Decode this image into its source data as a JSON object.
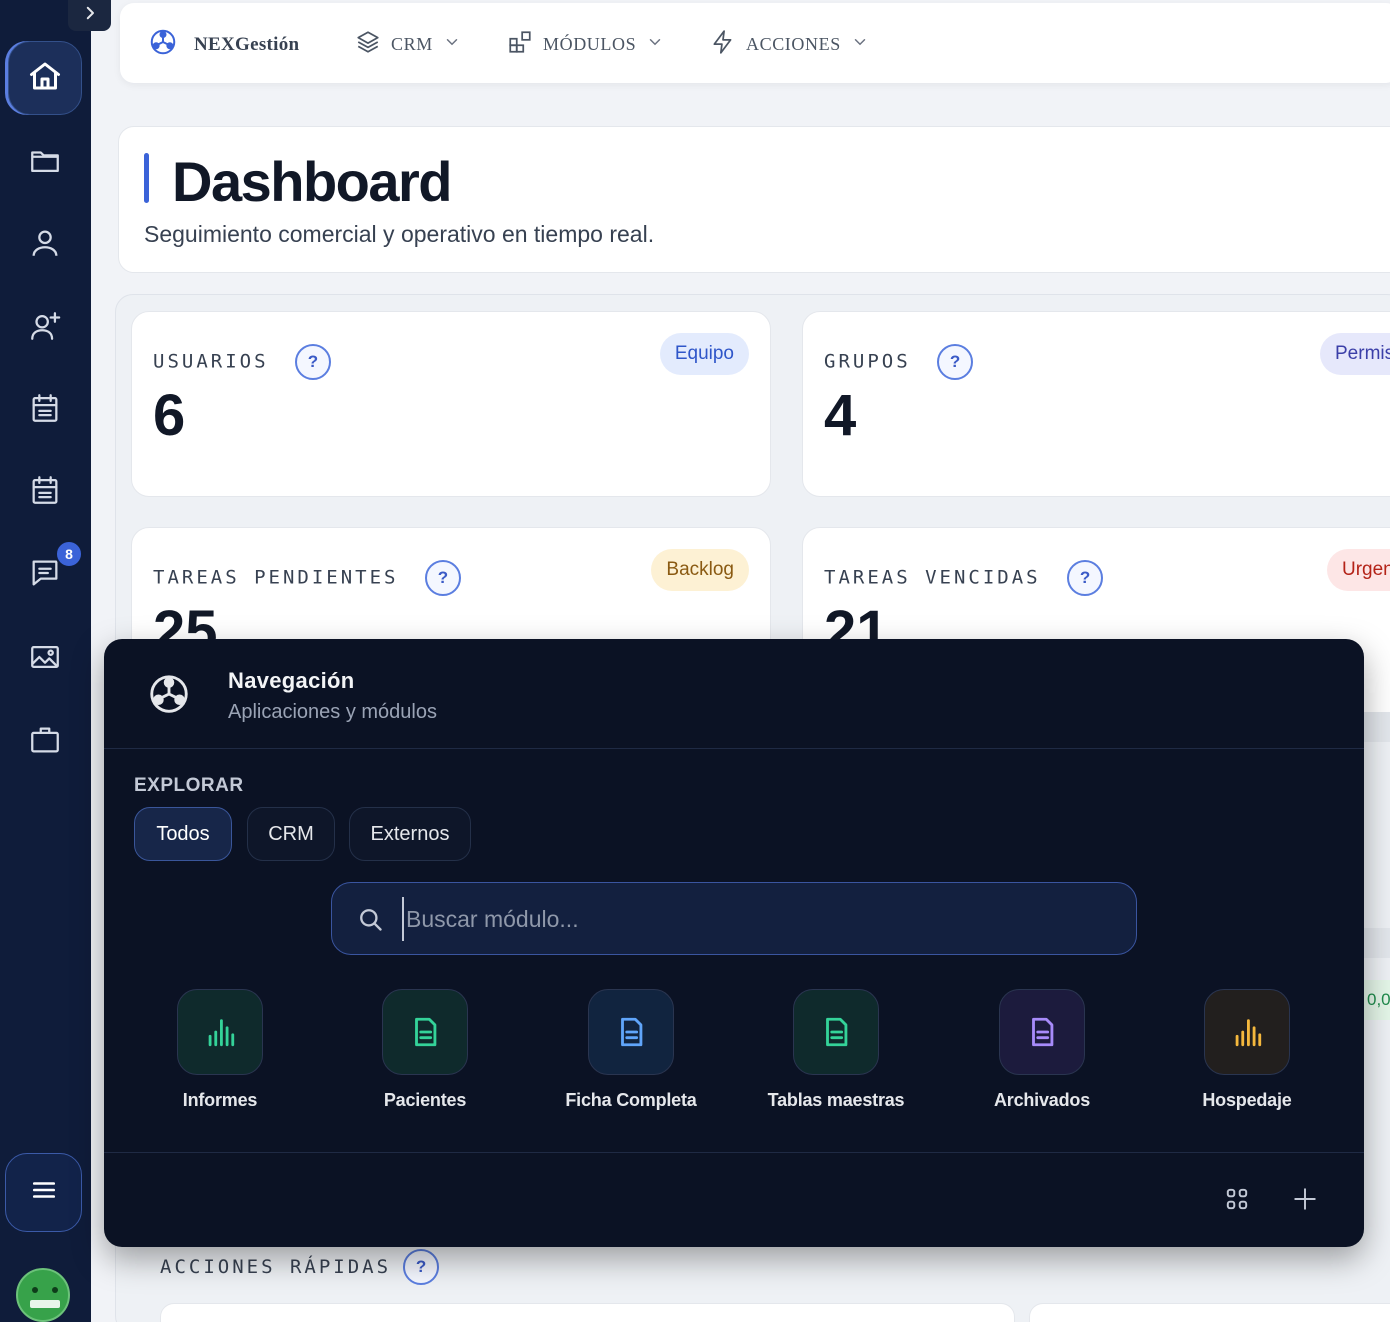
{
  "topbar": {
    "brand": "NEXGestión",
    "nav": [
      {
        "label": "CRM",
        "icon": "layers-icon"
      },
      {
        "label": "MÓDULOS",
        "icon": "blocks-icon"
      },
      {
        "label": "ACCIONES",
        "icon": "bolt-icon"
      }
    ]
  },
  "sidebar": {
    "items": [
      {
        "name": "home",
        "icon": "home-icon"
      },
      {
        "name": "folder",
        "icon": "folder-icon"
      },
      {
        "name": "user",
        "icon": "user-icon"
      },
      {
        "name": "add-user",
        "icon": "user-plus-icon"
      },
      {
        "name": "calendar",
        "icon": "calendar-icon"
      },
      {
        "name": "calendar-2",
        "icon": "calendar-icon"
      },
      {
        "name": "messages",
        "icon": "chat-icon"
      },
      {
        "name": "gallery",
        "icon": "image-icon"
      },
      {
        "name": "briefcase",
        "icon": "briefcase-icon"
      }
    ],
    "messages_badge": "8"
  },
  "header": {
    "title": "Dashboard",
    "subtitle": "Seguimiento comercial y operativo en tiempo real."
  },
  "stats": [
    {
      "label": "USUARIOS",
      "value": "6",
      "tag": "Equipo"
    },
    {
      "label": "GRUPOS",
      "value": "4",
      "tag": "Permisos"
    },
    {
      "label": "TAREAS PENDIENTES",
      "value": "25",
      "tag": "Backlog"
    },
    {
      "label": "TAREAS VENCIDAS",
      "value": "21",
      "tag": "Urgente"
    }
  ],
  "help_glyph": "?",
  "glimpse_value": "0,0",
  "quick_actions": {
    "label": "ACCIONES RÁPIDAS"
  },
  "nav_popup": {
    "title": "Navegación",
    "subtitle": "Aplicaciones y módulos",
    "explore_label": "EXPLORAR",
    "filters": [
      {
        "label": "Todos",
        "active": true
      },
      {
        "label": "CRM",
        "active": false
      },
      {
        "label": "Externos",
        "active": false
      }
    ],
    "search": {
      "value": "",
      "placeholder": "Buscar módulo..."
    },
    "modules": [
      {
        "label": "Informes",
        "icon": "bar-chart-icon",
        "color": "#34d399"
      },
      {
        "label": "Pacientes",
        "icon": "document-icon",
        "color": "#34d399"
      },
      {
        "label": "Ficha Completa",
        "icon": "document-icon",
        "color": "#60a5fa"
      },
      {
        "label": "Tablas maestras",
        "icon": "document-icon",
        "color": "#34d399"
      },
      {
        "label": "Archivados",
        "icon": "document-icon",
        "color": "#a78bfa"
      },
      {
        "label": "Hospedaje",
        "icon": "bar-chart-icon",
        "color": "#f5b83d"
      }
    ]
  },
  "colors": {
    "sidebar_bg": "#0f1c3a",
    "accent": "#3b63d8",
    "popup_bg": "#0b1224"
  }
}
